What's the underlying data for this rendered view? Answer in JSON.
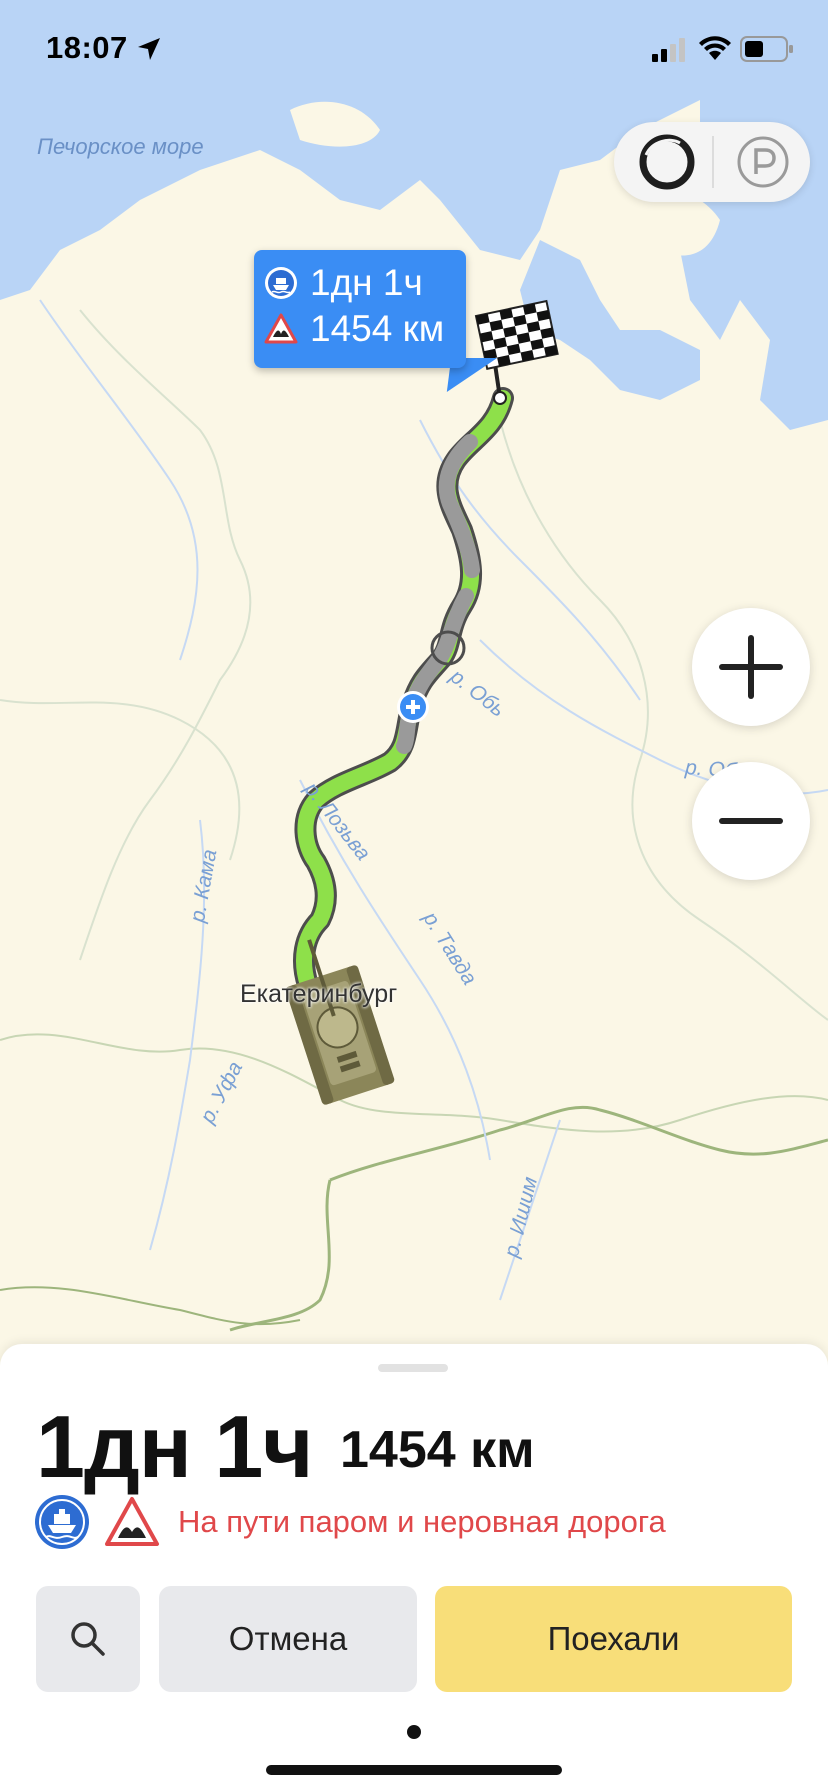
{
  "status_bar": {
    "time": "18:07"
  },
  "map": {
    "sea_label": "Печорское море",
    "city_label": "Екатеринбург",
    "rivers": {
      "ob_1": "р. Обь",
      "ob_2": "р. Обь",
      "sosva": "р. Лозьва",
      "tavda": "р. Тавда",
      "kama": "р. Кама",
      "ufa": "р. Уфа",
      "ishim": "р. Ишим"
    },
    "colors": {
      "land": "#fbf7e6",
      "water": "#b9d4f6",
      "route_green": "#8ee04a",
      "route_gray": "#9a9a9a",
      "bubble": "#3a8df4"
    }
  },
  "route_bubble": {
    "ferry_icon": "ferry-icon",
    "time": "1дн 1ч",
    "warning_icon": "rough-road-icon",
    "distance": "1454 км"
  },
  "controls": {
    "alice_icon": "alice-icon",
    "parking_icon": "parking-icon",
    "zoom_in_icon": "plus-icon",
    "zoom_out_icon": "minus-icon"
  },
  "sheet": {
    "time": "1дн 1ч",
    "distance": "1454 км",
    "warning_text": "На пути паром и неровная дорога",
    "buttons": {
      "search_icon": "search-icon",
      "cancel": "Отмена",
      "go": "Поехали"
    },
    "colors": {
      "warning": "#e0484a",
      "go": "#f8de79",
      "neutral": "#e8e9ec"
    }
  }
}
